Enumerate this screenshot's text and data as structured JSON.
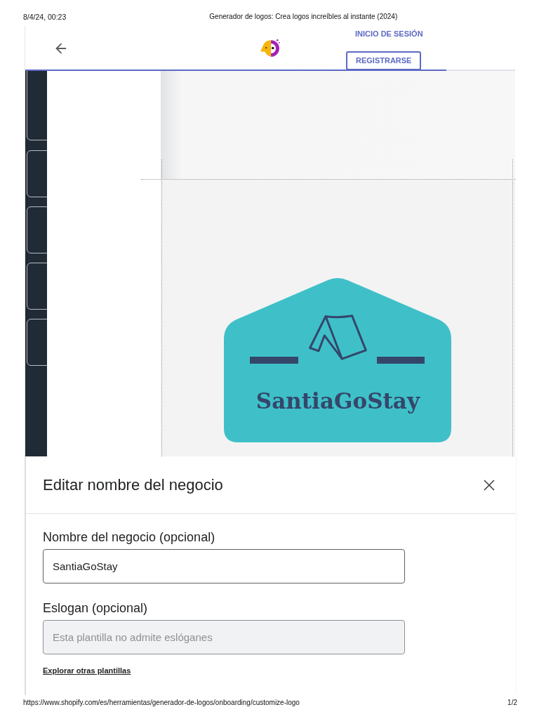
{
  "print_header": {
    "date": "8/4/24, 00:23",
    "title": "Generador de logos: Crea logos increíbles al instante (2024)"
  },
  "header": {
    "login_link": "INICIO DE SESIÓN",
    "register_button": "REGISTRARSE",
    "progress": {
      "level": 0.86
    }
  },
  "logo": {
    "name": "SantiaGoStay"
  },
  "sheet": {
    "title": "Editar nombre del negocio",
    "fields": [
      {
        "label": "Nombre del negocio (opcional)",
        "value": "SantiaGoStay",
        "disabled": false
      },
      {
        "label": "Eslogan (opcional)",
        "placeholder": "Esta plantilla no admite eslóganes",
        "disabled": true
      }
    ],
    "link": "Explorar otras plantillas"
  },
  "print_footer": {
    "url": "https://www.shopify.com/es/herramientas/generador-de-logos/onboarding/customize-logo",
    "page": "1/2"
  }
}
